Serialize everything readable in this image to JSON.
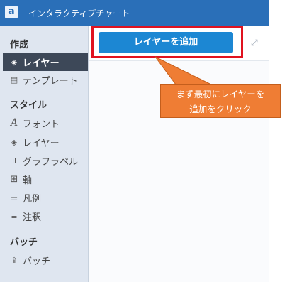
{
  "app": {
    "logo": "a",
    "title": "インタラクティブチャート"
  },
  "sidebar": {
    "sections": [
      {
        "heading": "作成",
        "items": [
          {
            "label": "レイヤー",
            "icon": "layers-icon",
            "active": true
          },
          {
            "label": "テンプレート",
            "icon": "template-icon",
            "active": false
          }
        ]
      },
      {
        "heading": "スタイル",
        "items": [
          {
            "label": "フォント",
            "icon": "font-icon"
          },
          {
            "label": "レイヤー",
            "icon": "layers-icon"
          },
          {
            "label": "グラフラベル",
            "icon": "bar-chart-icon"
          },
          {
            "label": "軸",
            "icon": "axis-grid-icon"
          },
          {
            "label": "凡例",
            "icon": "legend-list-icon"
          },
          {
            "label": "注釈",
            "icon": "annotation-icon"
          }
        ]
      },
      {
        "heading": "バッチ",
        "items": [
          {
            "label": "バッチ",
            "icon": "batch-icon"
          }
        ]
      }
    ]
  },
  "main": {
    "add_layer_label": "レイヤーを追加"
  },
  "callout": {
    "line1": "まず最初にレイヤーを",
    "line2": "追加をクリック"
  },
  "colors": {
    "titlebar": "#2a6fb8",
    "button": "#1c87d3",
    "highlight": "#e0121f",
    "callout": "#ef7d34",
    "active_item": "#3d4858"
  }
}
